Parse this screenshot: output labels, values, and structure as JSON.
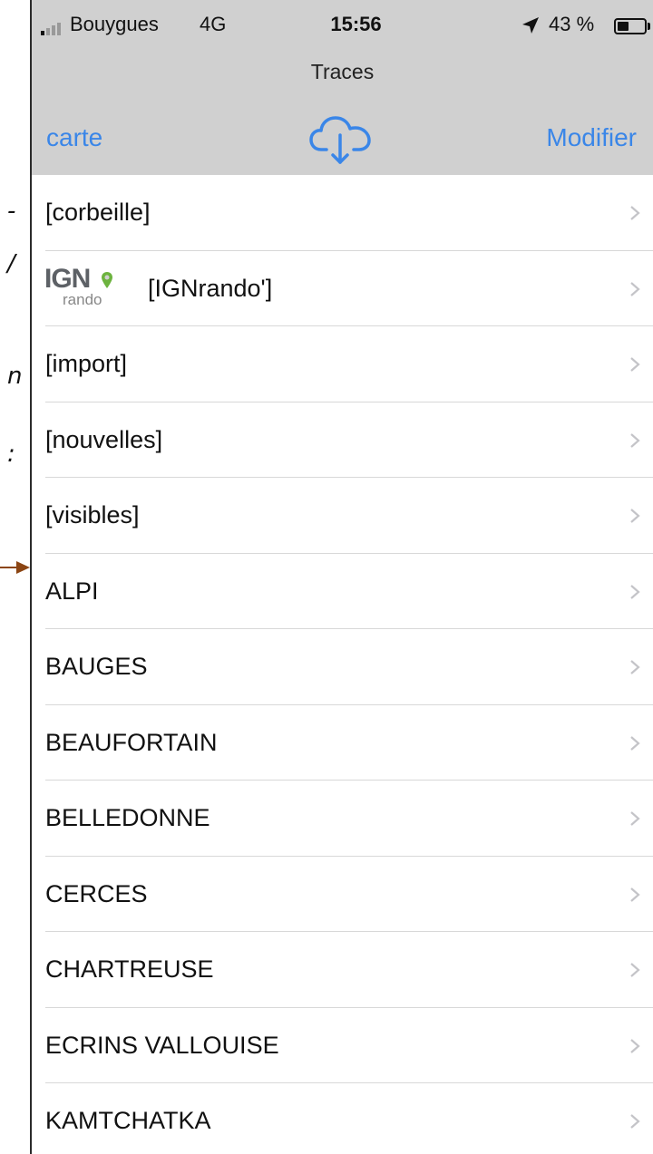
{
  "left_document": {
    "fragments": [
      "-",
      "/",
      "n",
      ":"
    ]
  },
  "status_bar": {
    "carrier": "Bouygues",
    "network": "4G",
    "time": "15:56",
    "battery": "43 %",
    "battery_level": 0.43
  },
  "nav": {
    "title": "Traces",
    "left_button": "carte",
    "right_button": "Modifier",
    "cloud_icon": "cloud-download-icon"
  },
  "logo": {
    "main": "IGN",
    "sub": "rando"
  },
  "list": {
    "items": [
      {
        "label": "[corbeille]"
      },
      {
        "label": "[IGNrando']"
      },
      {
        "label": "[import]"
      },
      {
        "label": "[nouvelles]"
      },
      {
        "label": "[visibles]"
      },
      {
        "label": "ALPI"
      },
      {
        "label": "BAUGES"
      },
      {
        "label": "BEAUFORTAIN"
      },
      {
        "label": "BELLEDONNE"
      },
      {
        "label": "CERCES"
      },
      {
        "label": "CHARTREUSE"
      },
      {
        "label": "ECRINS VALLOUISE"
      },
      {
        "label": "KAMTCHATKA"
      }
    ]
  },
  "colors": {
    "accent": "#3a86e8",
    "header_bg": "#d0d0d0",
    "arrow": "#8b4513"
  }
}
